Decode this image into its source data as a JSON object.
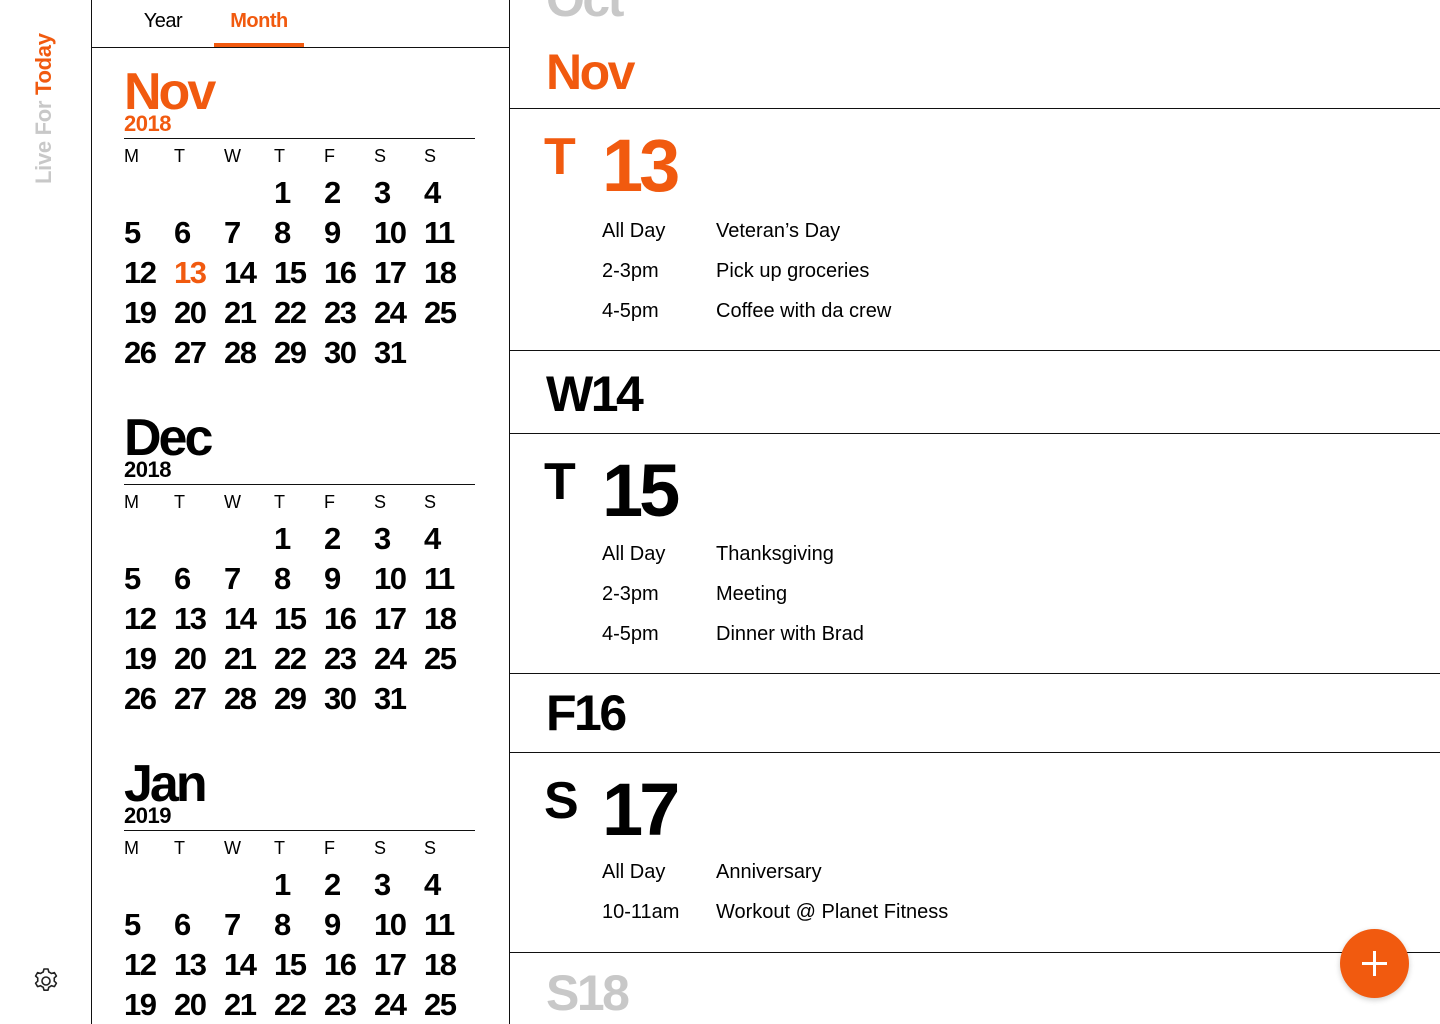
{
  "brand": {
    "part1": "Live For",
    "part2": "Today"
  },
  "tabs": [
    {
      "label": "Year"
    },
    {
      "label": "Month"
    }
  ],
  "dow": [
    "M",
    "T",
    "W",
    "T",
    "F",
    "S",
    "S"
  ],
  "months": [
    {
      "name": "Nov",
      "year": "2018",
      "today": "13",
      "weeks": [
        [
          "",
          "",
          "",
          "1",
          "2",
          "3",
          "4"
        ],
        [
          "5",
          "6",
          "7",
          "8",
          "9",
          "10",
          "11"
        ],
        [
          "12",
          "13",
          "14",
          "15",
          "16",
          "17",
          "18"
        ],
        [
          "19",
          "20",
          "21",
          "22",
          "23",
          "24",
          "25"
        ],
        [
          "26",
          "27",
          "28",
          "29",
          "30",
          "31",
          ""
        ]
      ]
    },
    {
      "name": "Dec",
      "year": "2018",
      "weeks": [
        [
          "",
          "",
          "",
          "1",
          "2",
          "3",
          "4"
        ],
        [
          "5",
          "6",
          "7",
          "8",
          "9",
          "10",
          "11"
        ],
        [
          "12",
          "13",
          "14",
          "15",
          "16",
          "17",
          "18"
        ],
        [
          "19",
          "20",
          "21",
          "22",
          "23",
          "24",
          "25"
        ],
        [
          "26",
          "27",
          "28",
          "29",
          "30",
          "31",
          ""
        ]
      ]
    },
    {
      "name": "Jan",
      "year": "2019",
      "weeks": [
        [
          "",
          "",
          "",
          "1",
          "2",
          "3",
          "4"
        ],
        [
          "5",
          "6",
          "7",
          "8",
          "9",
          "10",
          "11"
        ],
        [
          "12",
          "13",
          "14",
          "15",
          "16",
          "17",
          "18"
        ],
        [
          "19",
          "20",
          "21",
          "22",
          "23",
          "24",
          "25"
        ]
      ]
    }
  ],
  "agenda": {
    "prev_month": "Oct",
    "month": "Nov",
    "days": [
      {
        "letter": "T",
        "number": "13",
        "today": true,
        "events": [
          {
            "time": "All Day",
            "title": "Veteran’s Day"
          },
          {
            "time": "2-3pm",
            "title": "Pick up groceries"
          },
          {
            "time": "4-5pm",
            "title": "Coffee with da crew"
          }
        ]
      },
      {
        "collapsed": "W14"
      },
      {
        "letter": "T",
        "number": "15",
        "events": [
          {
            "time": "All Day",
            "title": "Thanksgiving"
          },
          {
            "time": "2-3pm",
            "title": "Meeting"
          },
          {
            "time": "4-5pm",
            "title": "Dinner with Brad"
          }
        ]
      },
      {
        "collapsed": "F16"
      },
      {
        "letter": "S",
        "number": "17",
        "events": [
          {
            "time": "All Day",
            "title": "Anniversary"
          },
          {
            "time": "10-11am",
            "title": "Workout @ Planet Fitness"
          }
        ]
      },
      {
        "collapsed": "S18"
      }
    ]
  },
  "icons": {
    "settings": "gear-icon",
    "add": "plus-icon"
  },
  "colors": {
    "accent": "#f15a0f",
    "muted": "#c8c8c8",
    "text": "#000000"
  }
}
